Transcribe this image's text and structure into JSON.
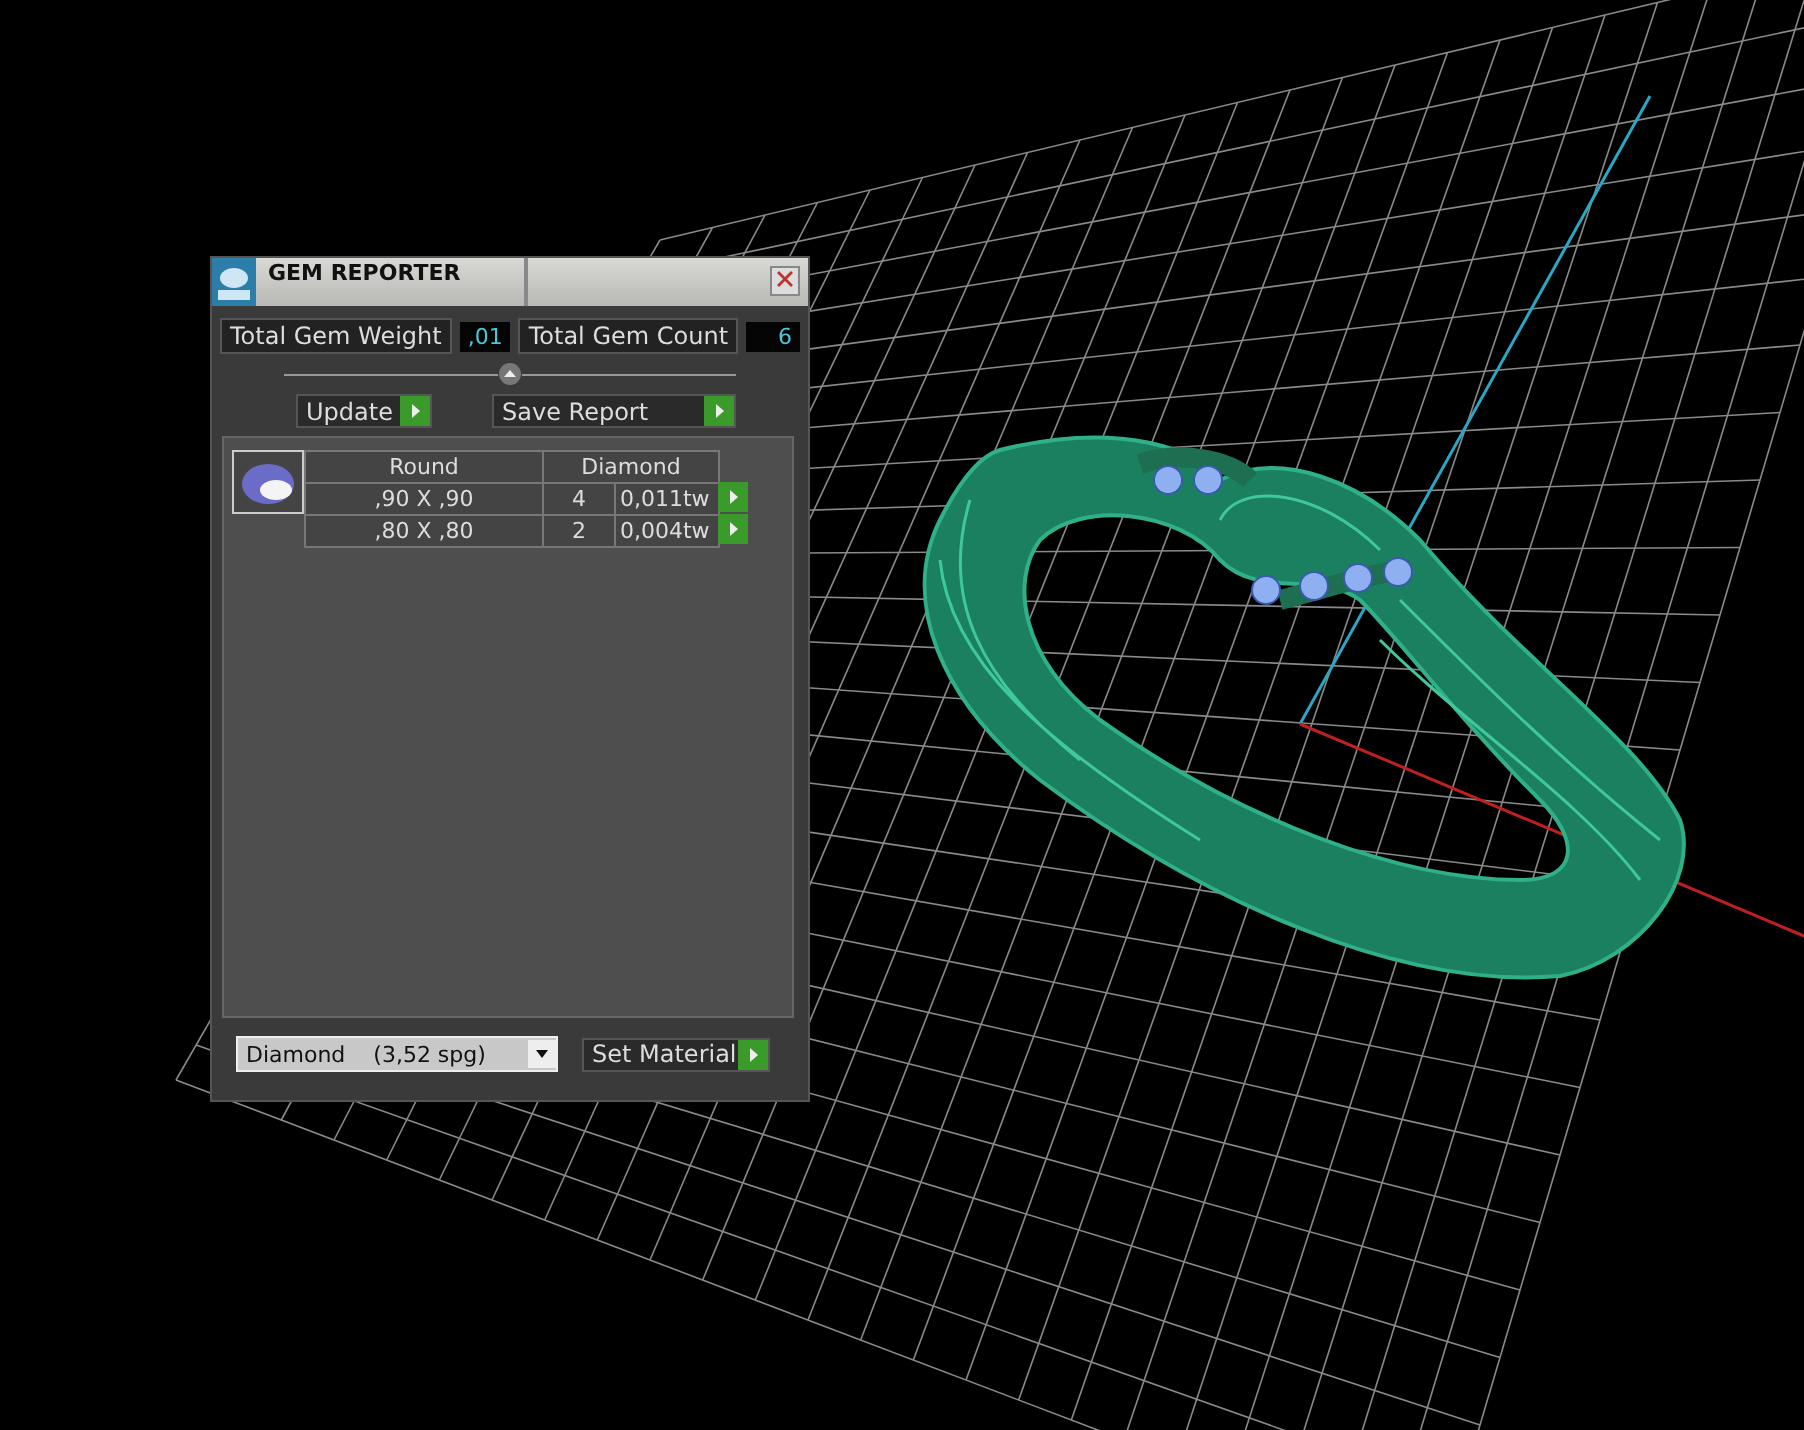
{
  "panel": {
    "title": "GEM REPORTER",
    "totals": [
      {
        "label": "Total Gem Weight",
        "value": ",01"
      },
      {
        "label": "Total Gem Count",
        "value": "6"
      }
    ],
    "actions": [
      {
        "label": "Update"
      },
      {
        "label": "Save Report"
      }
    ],
    "table": {
      "columns": [
        "Round",
        "Diamond"
      ],
      "rows": [
        {
          "size": ",90 X ,90",
          "count": "4",
          "weight": "0,011tw"
        },
        {
          "size": ",80 X ,80",
          "count": "2",
          "weight": "0,004tw"
        }
      ]
    },
    "material": {
      "value": "Diamond    (3,52 spg)"
    },
    "set_button": "Set Material"
  }
}
